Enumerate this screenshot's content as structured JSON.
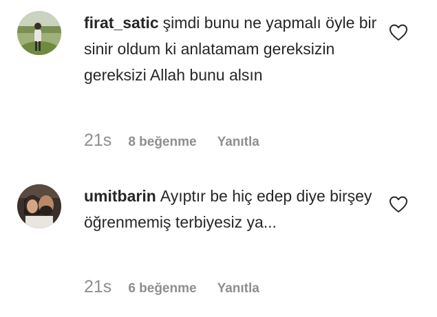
{
  "comments": [
    {
      "username": "firat_satic",
      "text": "şimdi bunu ne yapmalı öyle bir sinir oldum ki anlatamam gereksizin gereksizi Allah bunu alsın",
      "time": "21s",
      "likes": "8 beğenme",
      "reply": "Yanıtla",
      "avatar_icon": "avatar-photo-outdoor",
      "like_icon": "heart-outline-icon"
    },
    {
      "username": "umitbarin",
      "text": "Ayıptır be hiç edep diye birşey öğrenmemiş terbiyesiz ya...",
      "time": "21s",
      "likes": "6 beğenme",
      "reply": "Yanıtla",
      "avatar_icon": "avatar-photo-couple",
      "like_icon": "heart-outline-icon"
    }
  ],
  "colors": {
    "text": "#262626",
    "meta": "#8e8e8e",
    "background": "#ffffff"
  }
}
